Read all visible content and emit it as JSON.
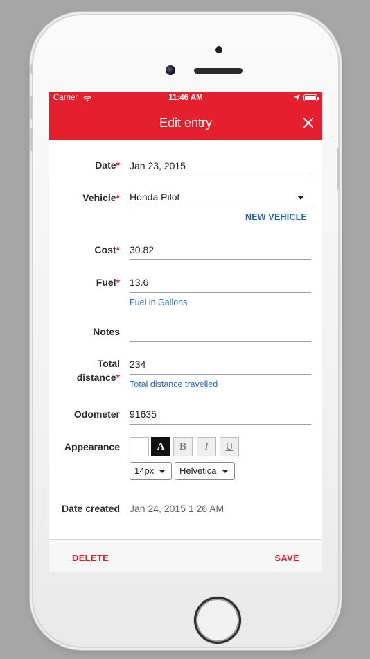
{
  "status_bar": {
    "carrier": "Carrier",
    "time": "11:46 AM"
  },
  "navbar": {
    "title": "Edit entry",
    "close_icon": "close-icon"
  },
  "form": {
    "date": {
      "label": "Date",
      "required": "*",
      "value": "Jan 23, 2015"
    },
    "vehicle": {
      "label": "Vehicle",
      "required": "*",
      "value": "Honda Pilot",
      "new_vehicle": "NEW VEHICLE"
    },
    "cost": {
      "label": "Cost",
      "required": "*",
      "value": "30.82"
    },
    "fuel": {
      "label": "Fuel",
      "required": "*",
      "value": "13.6",
      "hint": "Fuel in Gallons"
    },
    "notes": {
      "label": "Notes",
      "value": ""
    },
    "total_distance": {
      "label_line1": "Total",
      "label_line2": "distance",
      "required": "*",
      "value": "234",
      "hint": "Total distance travelled"
    },
    "odometer": {
      "label": "Odometer",
      "value": "91635"
    },
    "appearance": {
      "label": "Appearance",
      "buttons": [
        "",
        "A",
        "B",
        "I",
        "U"
      ],
      "font_size": "14px",
      "font_family": "Helvetica"
    },
    "date_created": {
      "label": "Date created",
      "value": "Jan 24, 2015 1:26 AM"
    }
  },
  "toolbar": {
    "delete": "DELETE",
    "save": "SAVE"
  },
  "colors": {
    "accent": "#e5202e",
    "link": "#1f63ad",
    "danger": "#d42030"
  }
}
